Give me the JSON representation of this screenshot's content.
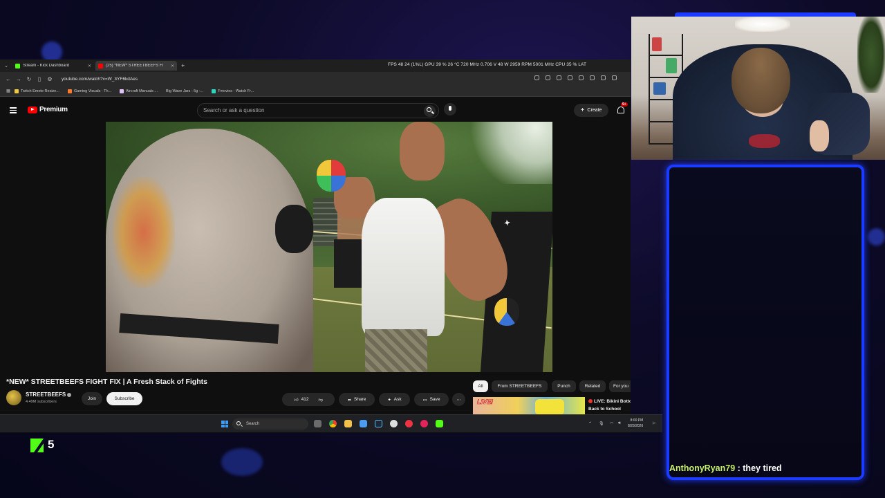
{
  "browser": {
    "tabs": [
      {
        "title": "Stream - Kick Dashboard",
        "color": "#53fc18"
      },
      {
        "title": "(25) *NEW* STREETBEEFS FI",
        "color": "#ff0000"
      }
    ],
    "perf_overlay": "FPS   48   24 (1%L)   GPU  39 %  26 °C  720 MHz  0.706 V  48 W  2959 RPM  5001 MHz  CPU 35 %   LAT",
    "url": "youtube.com/watch?v=W_3YF6kdAes",
    "bookmarks": [
      "Twitch Emote Resize...",
      "Gaming Visuals - Th...",
      "Aircraft Manuals ...",
      "Big Wave Jars - 5g -...",
      "Fmovies - Watch Fr..."
    ]
  },
  "youtube": {
    "logo_text": "Premium",
    "search_placeholder": "Search or ask a question",
    "create_label": "Create",
    "notifications_badge": "9+",
    "video_title": "*NEW* STREETBEEFS FIGHT FIX | A Fresh Stack of Fights",
    "channel_name": "STREETBEEFS",
    "subscribers": "4.49M subscribers",
    "join_label": "Join",
    "subscribe_label": "Subscribe",
    "like_count": "412",
    "share_label": "Share",
    "ask_label": "Ask",
    "save_label": "Save",
    "chips": [
      "All",
      "From STREETBEEFS",
      "Punch",
      "Related",
      "For you"
    ],
    "rec_thumb_text": "LIVE!",
    "rec_title": "LIVE: Bikini Bottom Back to School"
  },
  "taskbar": {
    "search_label": "Search",
    "time": "8:00 PM",
    "date": "8/29/2026"
  },
  "chat": {
    "username": "AnthonyRyan79",
    "separator": " : ",
    "message": "they tired"
  },
  "kick": {
    "viewer_count": "5"
  }
}
